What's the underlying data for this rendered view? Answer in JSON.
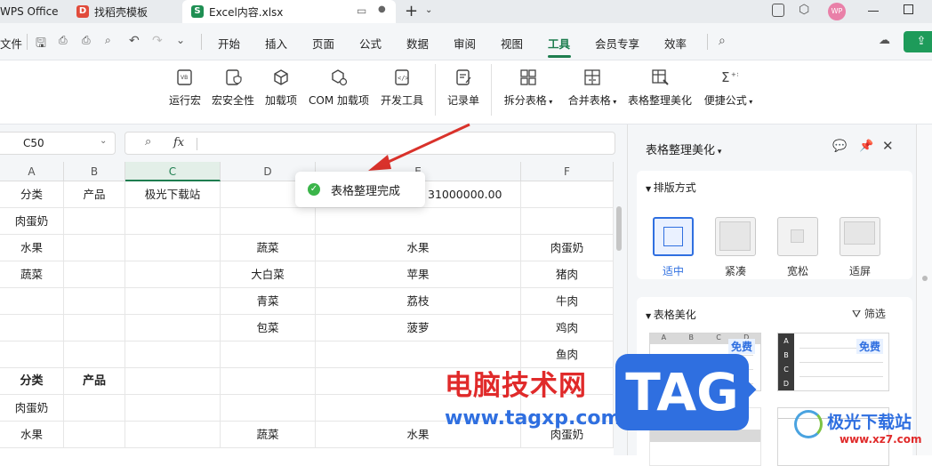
{
  "titlebar": {
    "tabs": [
      {
        "label": "WPS Office"
      },
      {
        "label": "找稻壳模板"
      },
      {
        "label": "Excel内容.xlsx"
      }
    ],
    "avatar_initials": "WP"
  },
  "menubar": {
    "file_label": "文件",
    "items": [
      "开始",
      "插入",
      "页面",
      "公式",
      "数据",
      "审阅",
      "视图",
      "工具",
      "会员专享",
      "效率"
    ],
    "active": "工具"
  },
  "ribbon": {
    "buttons": [
      "运行宏",
      "宏安全性",
      "加载项",
      "COM 加载项",
      "开发工具",
      "记录单",
      "拆分表格",
      "合并表格",
      "表格整理美化",
      "便捷公式"
    ]
  },
  "formula_bar": {
    "name_box": "C50",
    "fx_label": "fx",
    "value": ""
  },
  "grid": {
    "columns": [
      "A",
      "B",
      "C",
      "D",
      "E",
      "F"
    ],
    "rows": [
      [
        "分类",
        "产品",
        "极光下载站",
        "",
        "31000000.00",
        ""
      ],
      [
        "肉蛋奶",
        "",
        "",
        "",
        "",
        ""
      ],
      [
        "水果",
        "",
        "",
        "蔬菜",
        "水果",
        "肉蛋奶"
      ],
      [
        "蔬菜",
        "",
        "",
        "大白菜",
        "苹果",
        "猪肉"
      ],
      [
        "",
        "",
        "",
        "青菜",
        "荔枝",
        "牛肉"
      ],
      [
        "",
        "",
        "",
        "包菜",
        "菠萝",
        "鸡肉"
      ],
      [
        "",
        "",
        "",
        "",
        "",
        "鱼肉"
      ],
      [
        "分类",
        "产品",
        "",
        "",
        "",
        ""
      ],
      [
        "肉蛋奶",
        "",
        "",
        "",
        "",
        ""
      ],
      [
        "水果",
        "",
        "",
        "蔬菜",
        "水果",
        "肉蛋奶"
      ]
    ]
  },
  "toast": {
    "message": "表格整理完成"
  },
  "panel": {
    "title": "表格整理美化",
    "layout_section": "排版方式",
    "layout_options": [
      "适中",
      "紧凑",
      "宽松",
      "适屏"
    ],
    "layout_selected": "适中",
    "beautify_section": "表格美化",
    "filter_label": "筛选",
    "free_badge": "免费",
    "template_headers": [
      "A",
      "B",
      "C",
      "D"
    ]
  },
  "watermark": {
    "text_cn": "电脑技术网",
    "url": "www.tagxp.com",
    "tag": "TAG",
    "logo_cn": "极光下载站",
    "logo_url": "www.xz7.com"
  },
  "colors": {
    "accent": "#1e7d4f",
    "wps_red": "#e14b3b",
    "excel_green": "#1f8f53",
    "toast_ok": "#3bb54a",
    "arrow": "#d9322b",
    "free_blue": "#2f6fe0"
  }
}
